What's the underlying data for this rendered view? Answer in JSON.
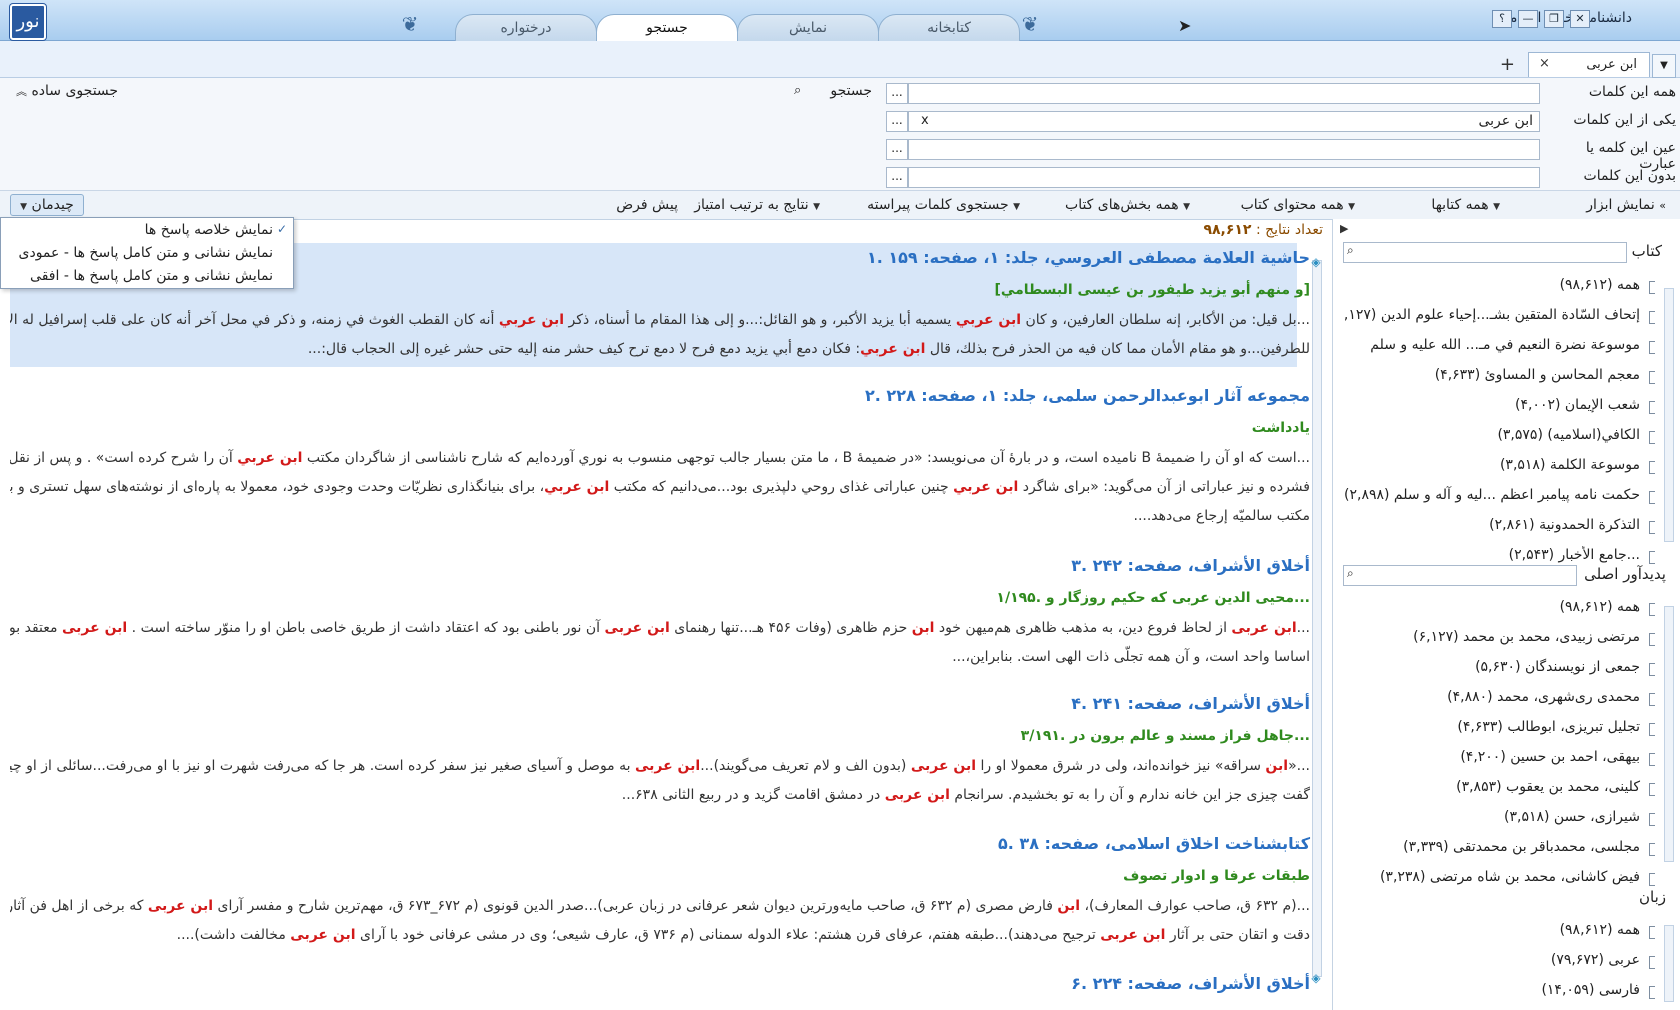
{
  "app": {
    "title": "دانشنامه اخلاق اسلامی",
    "logo": "نور"
  },
  "window_buttons": [
    "؟",
    "—",
    "❐",
    "✕"
  ],
  "tabs": [
    {
      "label": "درختواره",
      "active": false
    },
    {
      "label": "جستجو",
      "active": true
    },
    {
      "label": "نمایش",
      "active": false
    },
    {
      "label": "کتابخانه",
      "active": false
    }
  ],
  "doc_tab": {
    "label": "ابن عربی",
    "close": "×",
    "add": "+"
  },
  "search": {
    "rows": [
      {
        "label": "همه این کلمات",
        "value": "",
        "dots": "..."
      },
      {
        "label": "یکی از این کلمات",
        "value": "ابن عربی",
        "dots": "...",
        "clear": "x"
      },
      {
        "label": "عین این کلمه یا عبارت",
        "value": "",
        "dots": "..."
      },
      {
        "label": "بدون این کلمات",
        "value": "",
        "dots": "..."
      }
    ],
    "search_button": "جستجو",
    "simple_search": "جستجوی ساده"
  },
  "toolbar": {
    "show_tools": "نمایش ابزار",
    "all_books": "همه کتابها",
    "all_content": "همه محتوای کتاب",
    "all_sections": "همه بخش‌های کتاب",
    "pruned_words": "جستجوی کلمات پیراسته",
    "sort_by_score": "نتایج به ترتیب امتیاز",
    "default": "پیش فرض",
    "layout": "چیدمان"
  },
  "layout_menu": [
    {
      "label": "نمایش خلاصه پاسخ ها",
      "checked": true
    },
    {
      "label": "نمایش نشانی و متن کامل پاسخ ها - عمودی",
      "checked": false
    },
    {
      "label": "نمایش نشانی و متن کامل پاسخ ها - افقی",
      "checked": false
    }
  ],
  "result_count": {
    "label": "تعداد نتایج :",
    "value": "۹۸,۶۱۲"
  },
  "results": [
    {
      "title": "۱. حاشية العلامة مصطفى العروسي، جلد: ۱، صفحه: ۱۵۹",
      "subtitle": "[و منهم أبو يزيد طيفور بن عيسى البسطامي]",
      "lines": [
        "...بل قيل: من الأكابر، إنه سلطان العارفين، و كان ابن عربي يسميه أبا يزيد الأكبر، و هو القائل:...و إلى هذا المقام ما أسناه، ذكر ابن عربي أنه كان القطب الغوث في زمنه، و ذكر في محل آخر أنه كان على قلب إسرافيل له الأمر و نقيضه جامع",
        "للطرفين...و هو مقام الأمان مما كان فيه من الحذر فرح بذلك، قال ابن عربي: فكان دمع أبي يزيد دمع فرح لا دمع ترح كيف حشر منه إليه حتى حشر غيره إلى الحجاب قال:..."
      ]
    },
    {
      "title": "۲. مجموعه آثار ابوعبدالرحمن سلمی، جلد: ۱، صفحه: ۲۲۸",
      "subtitle": "یادداشت",
      "lines": [
        "...است که او آن را ضميمۀ B ناميده است، و در بارۀ آن می‌نويسد: «در ضميمۀ B ، ما متن بسيار جالب توجهی منسوب به نوري آورده‌ايم كه شارح ناشناسی از شاگردان مكتب ابن عربي آن را شرح كرده است» . و پس از نقل خلاصۀ",
        "فشرده و نيز عباراتی از آن می‌گويد: «برای شاگرد ابن عربي چنين عباراتی غذای روحي دلپذيری بود...می‌دانيم كه مكتب ابن عربي، برای بنيانگذاری نظريّات وحدت وجودی خود، معمولا به پاره‌ای از نوشته‌های سهل تستری و بعضی آراء",
        "مكتب سالميّه إرجاع می‌دهد...."
      ]
    },
    {
      "title": "۳. أخلاق الأشراف، صفحه: ۲۴۲",
      "subtitle": "۱/۱۹۵. محيی الدين عربی كه حكيم روزگار و...",
      "lines": [
        "...ابن عربی از لحاظ فروع دين، به مذهب ظاهری هم‌ميهن خود ابن حزم ظاهری (وفات ۴۵۶ هـ...تنها رهنمای ابن عربی آن نور باطنی بود كه اعتقاد داشت از طريق خاصی باطن او را منوّر ساخته است . ابن عربی معتقد بود كه همۀ هستی",
        "اساسا واحد است، و آن همه تجلّی ذات الهی است. بنابراين،..."
      ]
    },
    {
      "title": "۴. أخلاق الأشراف، صفحه: ۲۴۱",
      "subtitle": "۳/۱۹۱. جاهل فراز مسند و عالم برون در...",
      "lines": [
        "...«ابن سراقه» نيز خوانده‌اند، ولی در شرق معمولا او را ابن عربی (بدون الف و لام تعريف می‌گويند)...ابن عربی به موصل و آسيای صغير نيز سفر كرده است. هر جا كه می‌رفت شهرت او نيز با او می‌رفت...سائلی از او چيزی خواست و او",
        "گفت چيزی جز اين خانه ندارم و آن را به تو بخشيدم. سرانجام ابن عربی در دمشق اقامت گزيد و در ربيع الثانی ۶۳۸..."
      ]
    },
    {
      "title": "۵. كتابشناخت اخلاق اسلامی، صفحه: ۳۸",
      "subtitle": "طبقات عرفا و ادوار تصوف",
      "lines": [
        "...(م ۶۳۲ ق، صاحب عوارف المعارف)، ابن فارض مصری (م ۶۳۲ ق، صاحب مايه‌ورترين ديوان شعر عرفانی در زبان عربی)...صدر الدين قونوی (م ۶۷۲_۶۷۳ ق، مهم‌ترين شارح و مفسر آرای ابن عربی كه برخی از اهل فن آثار وی را از نظر",
        "دقت و اتقان حتی بر آثار ابن عربی ترجيح می‌دهند)...طبقه هفتم، عرفای قرن هشتم: علاء الدوله سمنانی (م ۷۳۶ ق، عارف شيعی؛ وی در مشی عرفانی خود با آرای ابن عربی مخالفت داشت)...."
      ]
    },
    {
      "title": "۶. أخلاق الأشراف، صفحه: ۲۲۴",
      "subtitle": "",
      "lines": []
    }
  ],
  "highlight_term": "ابن عربي",
  "panel_books": {
    "header": "کتاب",
    "items": [
      "همه (۹۸,۶۱۲)",
      "إتحاف السّادة المتقين بشـ...إحياء علوم الدين (۶,۱۲۷)",
      "موسوعة نضرة النعيم في مـ... الله عليه و سلم",
      "معجم المحاسن و المساوئ (۴,۶۳۳)",
      "شعب الإيمان (۴,۰۰۲)",
      "الكافي(اسلاميه) (۳,۵۷۵)",
      "موسوعة الكلمة (۳,۵۱۸)",
      "حکمت نامه پیامبر اعظم ...لیه و آله و سلم (۲,۸۹۸)",
      "التذكرة الحمدونية (۲,۸۶۱)",
      "...جامع الأخبار (۲,۵۴۳)"
    ]
  },
  "panel_authors": {
    "header": "پدیدآور اصلی",
    "items": [
      "همه (۹۸,۶۱۲)",
      "مرتضی زبیدی، محمد بن محمد (۶,۱۲۷)",
      "جمعی از نویسندگان (۵,۶۳۰)",
      "محمدی ری‌شهری، محمد (۴,۸۸۰)",
      "تجلیل تبریزی، ابوطالب (۴,۶۳۳)",
      "بیهقی، احمد بن حسین (۴,۲۰۰)",
      "کلینی، محمد بن یعقوب (۳,۸۵۳)",
      "شیرازی، حسن (۳,۵۱۸)",
      "مجلسی، محمدباقر بن محمدتقی (۳,۳۳۹)",
      "فیض کاشانی، محمد بن شاه مرتضی (۳,۲۳۸)"
    ]
  },
  "panel_languages": {
    "header": "زبان",
    "items": [
      "همه (۹۸,۶۱۲)",
      "عربی (۷۹,۶۷۲)",
      "فارسی (۱۴,۰۵۹)"
    ]
  },
  "colors": {
    "highlight": "#d21919",
    "title": "#2a6fc2",
    "subtitle": "#2f8a1e",
    "count": "#8a4b00",
    "selected_bg": "#d7e6f8"
  },
  "icons": [
    "search-icon",
    "caret-down-icon",
    "double-chevron-up-icon",
    "check-icon",
    "play-icon",
    "diamond-scroll-icon"
  ]
}
